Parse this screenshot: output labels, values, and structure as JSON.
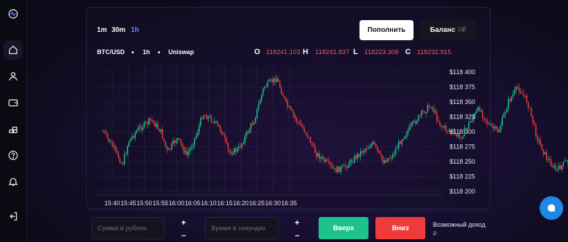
{
  "sidebar": {
    "items": [
      {
        "icon": "logo-pulse-icon"
      },
      {
        "icon": "home-icon",
        "active": true
      },
      {
        "icon": "user-icon"
      },
      {
        "icon": "wallet-icon"
      },
      {
        "icon": "coins-icon"
      },
      {
        "icon": "help-icon"
      },
      {
        "icon": "bell-icon"
      },
      {
        "icon": "logout-icon"
      }
    ]
  },
  "timeframes": [
    {
      "label": "1m",
      "active": false
    },
    {
      "label": "30m",
      "active": false
    },
    {
      "label": "1h",
      "active": true
    }
  ],
  "header": {
    "deposit_label": "Пополнить",
    "balance_label": "Баланс",
    "balance_amount": "0₽"
  },
  "market": {
    "pair": "BTC/USD",
    "interval": "1h",
    "source": "Uniswap",
    "o_label": "O",
    "o_value": "118241.103",
    "h_label": "H",
    "h_value": "118241.837",
    "l_label": "L",
    "l_value": "118223.308",
    "c_label": "C",
    "c_value": "118232.915"
  },
  "chart_data": {
    "type": "candlestick",
    "y_tick_labels": [
      "$118 400",
      "$118 375",
      "$118 350",
      "$118 325",
      "$118 300",
      "$118 275",
      "$118 250",
      "$118 225",
      "$118 200"
    ],
    "x_tick_labels": [
      "15:40",
      "15:45",
      "15:50",
      "15:55",
      "16:00",
      "16:05",
      "16:10",
      "16:15",
      "16:20",
      "16:25",
      "16:30",
      "16:35"
    ],
    "ylim": [
      118200,
      118400
    ],
    "close_path": [
      [
        15.37,
        118300
      ],
      [
        15.4,
        118275
      ],
      [
        15.43,
        118245
      ],
      [
        15.45,
        118285
      ],
      [
        15.48,
        118305
      ],
      [
        15.52,
        118320
      ],
      [
        15.55,
        118300
      ],
      [
        15.57,
        118265
      ],
      [
        15.6,
        118290
      ],
      [
        15.63,
        118260
      ],
      [
        15.66,
        118295
      ],
      [
        15.68,
        118330
      ],
      [
        15.71,
        118320
      ],
      [
        15.74,
        118300
      ],
      [
        15.76,
        118265
      ],
      [
        15.79,
        118270
      ],
      [
        15.82,
        118300
      ],
      [
        15.84,
        118320
      ],
      [
        15.87,
        118375
      ],
      [
        15.91,
        118390
      ],
      [
        15.94,
        118345
      ],
      [
        15.97,
        118320
      ],
      [
        16.0,
        118300
      ],
      [
        16.03,
        118265
      ],
      [
        16.06,
        118250
      ],
      [
        16.09,
        118235
      ],
      [
        16.12,
        118240
      ],
      [
        16.15,
        118255
      ],
      [
        16.18,
        118270
      ],
      [
        16.21,
        118280
      ],
      [
        16.24,
        118250
      ],
      [
        16.27,
        118260
      ],
      [
        16.3,
        118290
      ],
      [
        16.33,
        118310
      ],
      [
        16.36,
        118330
      ],
      [
        16.39,
        118345
      ],
      [
        16.42,
        118310
      ],
      [
        16.45,
        118300
      ],
      [
        16.48,
        118290
      ],
      [
        16.51,
        118315
      ],
      [
        16.54,
        118340
      ],
      [
        16.57,
        118310
      ],
      [
        16.6,
        118300
      ],
      [
        16.63,
        118350
      ],
      [
        16.66,
        118375
      ],
      [
        16.69,
        118350
      ],
      [
        16.72,
        118290
      ],
      [
        16.75,
        118255
      ],
      [
        16.78,
        118235
      ],
      [
        16.81,
        118250
      ],
      [
        16.84,
        118235
      ],
      [
        16.87,
        118230
      ]
    ]
  },
  "trade": {
    "amount_placeholder": "Сумма в рублях",
    "time_placeholder": "Время в секундах",
    "plus": "+",
    "minus": "–",
    "up_label": "Вверх",
    "down_label": "Вниз",
    "income_label": "Возможный доход",
    "income_currency": "₽"
  },
  "colors": {
    "up": "#1ec28c",
    "down": "#ef3b3b",
    "accent": "#6f86ff",
    "chat": "#1e88e5"
  }
}
